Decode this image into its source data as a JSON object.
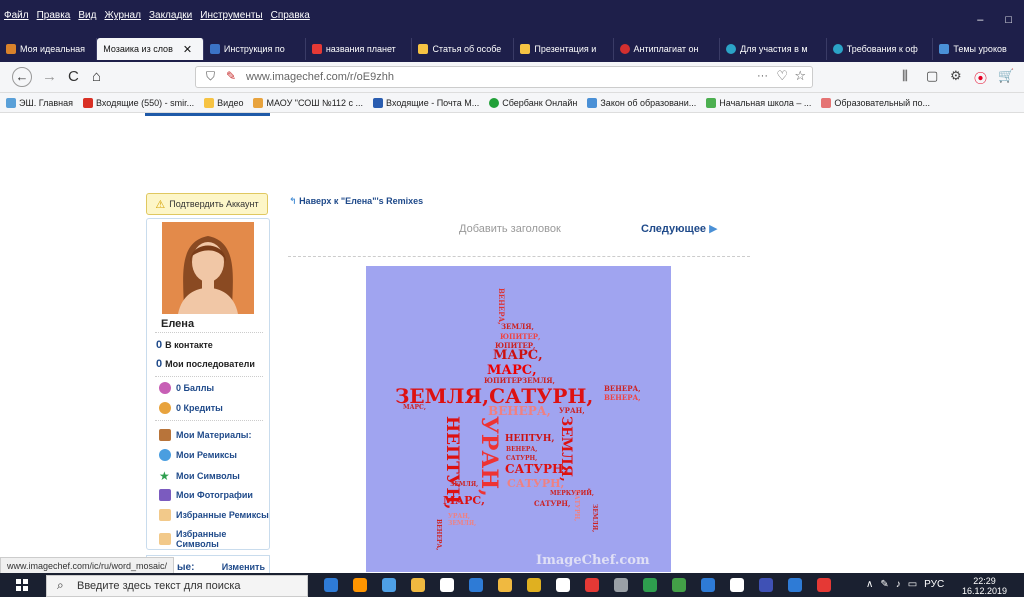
{
  "menu": [
    "Файл",
    "Правка",
    "Вид",
    "Журнал",
    "Закладки",
    "Инструменты",
    "Справка"
  ],
  "window_buttons": [
    "–",
    "□"
  ],
  "tabs": [
    {
      "label": "Моя идеальная",
      "color": "#d9822b",
      "active": false
    },
    {
      "label": "Мозаика из слов",
      "color": "#ffffff",
      "active": true
    },
    {
      "label": "Инструкция по",
      "color": "#3b73c6",
      "active": false
    },
    {
      "label": "названия планет",
      "color": "#e53935",
      "active": false
    },
    {
      "label": "Статья об особе",
      "color": "#f6c343",
      "active": false
    },
    {
      "label": "Презентация и",
      "color": "#f6c343",
      "active": false
    },
    {
      "label": "Антиплагиат он",
      "color": "#d32f2f",
      "active": false
    },
    {
      "label": "Для участия в м",
      "color": "#2ba3c7",
      "active": false
    },
    {
      "label": "Требования к оф",
      "color": "#2ba3c7",
      "active": false
    },
    {
      "label": "Темы уроков",
      "color": "#4a90d6",
      "active": false
    }
  ],
  "nav": {
    "back": "←",
    "forward": "→",
    "reload": "C",
    "home": "⌂",
    "url": "www.imagechef.com/r/oE9zhh",
    "more": "···"
  },
  "bookmarks": [
    {
      "label": "ЭШ. Главная",
      "color": "#5aa0d8"
    },
    {
      "label": "Входящие (550) - smir...",
      "color": "#d93025"
    },
    {
      "label": "Видео",
      "color": "#f6c343"
    },
    {
      "label": "МАОУ \"СОШ №112 с ...",
      "color": "#e8a33d"
    },
    {
      "label": "Входящие - Почта M...",
      "color": "#2a5db0"
    },
    {
      "label": "Сбербанк Онлайн",
      "color": "#21a038"
    },
    {
      "label": "Закон об образовани...",
      "color": "#4a90d6"
    },
    {
      "label": "Начальная школа – ...",
      "color": "#4caf50"
    },
    {
      "label": "Образовательный по...",
      "color": "#e57373"
    }
  ],
  "page": {
    "confirm": "Подтвердить Аккаунт",
    "back_link": "Наверх к \"Елена\"'s Remixes",
    "add_title": "Добавить заголовок",
    "next": "Следующее",
    "next_icon": "▶",
    "profile": {
      "name": "Елена",
      "contacts_count": "0",
      "contacts_label": "В контакте",
      "followers_count": "0",
      "followers_label": "Мои последователи",
      "points": "0 Баллы",
      "credits": "0 Кредиты",
      "links": [
        "Мои Материалы:",
        "Мои Ремиксы",
        "Мои Символы",
        "Мои Фотографии",
        "Избранные Ремиксы",
        "Избранные Символы"
      ]
    },
    "bottom_panel": {
      "left": "ые:",
      "right": "Изменить"
    },
    "status_url": "www.imagechef.com/ic/ru/word_mosaic/",
    "watermark": "ImageChef.com"
  },
  "mosaic_words": {
    "marsComma": "МАРС,",
    "earthSaturn": "ЗЕМЛЯ,САТУРН,",
    "venus": "ВЕНЕРА,",
    "uranus": "УРАН,",
    "neptune": "НЕПТУН,",
    "saturn": "САТУРН,",
    "earth": "ЗЕМЛЯ,",
    "jupiter": "ЮПИТЕР,",
    "jupiterEarth": "ЮПИТЕРЗЕМЛЯ,",
    "mercury": "МЕРКУРИЙ,",
    "mars": "МАРС,"
  },
  "taskbar": {
    "search_placeholder": "Введите здесь текст для поиска",
    "lang": "РУС",
    "time": "22:29",
    "date": "16.12.2019",
    "app_colors": [
      "#2e7bd6",
      "#ff9500",
      "#4ea0e6",
      "#f0b940",
      "#ffffff",
      "#2e7bd6",
      "#f0b940",
      "#e0b020",
      "#ffffff",
      "#e53935",
      "#9aa0a6",
      "#2e9e4e",
      "#43a047",
      "#2e7bd6",
      "#ffffff",
      "#3f51b5",
      "#2e7bd6",
      "#e53935"
    ]
  }
}
